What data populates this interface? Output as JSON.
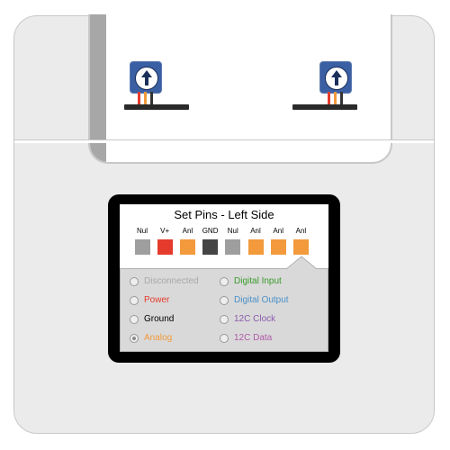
{
  "card": {
    "title": "Set Pins - Left Side",
    "pins": [
      {
        "label": "Nul",
        "color": "#9e9e9e"
      },
      {
        "label": "V+",
        "color": "#e53b2c"
      },
      {
        "label": "Anl",
        "color": "#f29a3c"
      },
      {
        "label": "GND",
        "color": "#454545"
      },
      {
        "label": "Nul",
        "color": "#9e9e9e"
      },
      {
        "label": "Anl",
        "color": "#f29a3c"
      },
      {
        "label": "Anl",
        "color": "#f29a3c"
      },
      {
        "label": "Anl",
        "color": "#f29a3c"
      }
    ],
    "selected_pin": 7
  },
  "options": {
    "left": [
      {
        "label": "Disconnected",
        "color": "#a8a8a8",
        "selected": false
      },
      {
        "label": "Power",
        "color": "#e53b2c",
        "selected": false
      },
      {
        "label": "Ground",
        "color": "#000000",
        "selected": false
      },
      {
        "label": "Analog",
        "color": "#f29a3c",
        "selected": true
      }
    ],
    "right": [
      {
        "label": "Digital Input",
        "color": "#3a9a2c",
        "selected": false
      },
      {
        "label": "Digital Output",
        "color": "#4a90c8",
        "selected": false
      },
      {
        "label": "12C Clock",
        "color": "#8a5ab0",
        "selected": false
      },
      {
        "label": "12C Data",
        "color": "#b05aa8",
        "selected": false
      }
    ]
  },
  "components": {
    "sensor_icon": "potentiometer-icon"
  }
}
